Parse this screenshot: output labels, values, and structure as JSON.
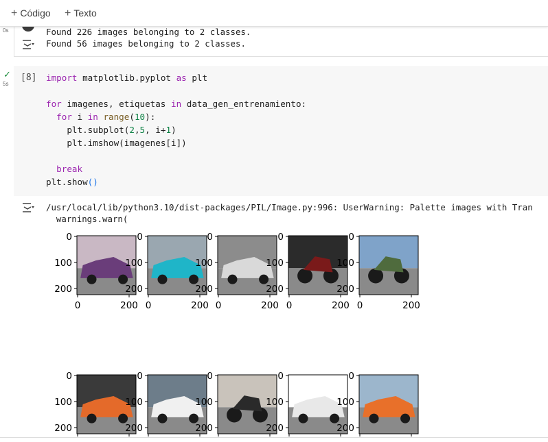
{
  "toolbar": {
    "add_code": "Código",
    "add_text": "Texto"
  },
  "cell1": {
    "exec_time": "0s",
    "output_lines": [
      "Found 226 images belonging to 2 classes.",
      "Found 56 images belonging to 2 classes."
    ]
  },
  "cell2": {
    "exec_time": "5s",
    "prompt": "[8]",
    "code": {
      "l1_kw": "import",
      "l1_rest": " matplotlib.pyplot ",
      "l1_kw2": "as",
      "l1_end": " plt",
      "l2_kw": "for",
      "l2_mid": " imagenes, etiquetas ",
      "l2_kw2": "in",
      "l2_end": " data_gen_entrenamiento:",
      "l3_kw": "for",
      "l3_mid": " i ",
      "l3_kw2": "in",
      "l3_fn": "range",
      "l3_open": "(",
      "l3_num": "10",
      "l3_close": "):",
      "l4_a": "plt.subplot(",
      "l4_n1": "2",
      "l4_c1": ",",
      "l4_n2": "5",
      "l4_c2": ", i+",
      "l4_n3": "1",
      "l4_end": ")",
      "l5": "plt.imshow(imagenes[i])",
      "l6_kw": "break",
      "l7_a": "plt.show",
      "l7_b": "()"
    },
    "output_warning": "/usr/local/lib/python3.10/dist-packages/PIL/Image.py:996: UserWarning: Palette images with Tran",
    "output_warning2": "  warnings.warn("
  },
  "chart_data": {
    "type": "image-grid",
    "rows": 2,
    "cols": 5,
    "x_ticks": [
      "0",
      "200"
    ],
    "y_ticks": [
      "0",
      "100",
      "200"
    ],
    "images": [
      {
        "subject": "purple car",
        "colors": [
          "#c9b8c4",
          "#6a3d7a"
        ]
      },
      {
        "subject": "teal car",
        "colors": [
          "#9aa7b0",
          "#1fb5c8"
        ]
      },
      {
        "subject": "silver car",
        "colors": [
          "#8c8c8c",
          "#d9d9d9"
        ]
      },
      {
        "subject": "black motorcycle",
        "colors": [
          "#2b2b2b",
          "#7a1a1a"
        ]
      },
      {
        "subject": "blue motorcycle",
        "colors": [
          "#7fa3c9",
          "#4f6b3d"
        ]
      },
      {
        "subject": "orange car",
        "colors": [
          "#3a3a3a",
          "#e46a2a"
        ]
      },
      {
        "subject": "white car",
        "colors": [
          "#6d7d8a",
          "#f0f0f0"
        ]
      },
      {
        "subject": "black motorcycle",
        "colors": [
          "#c9c3bb",
          "#2a2a2a"
        ]
      },
      {
        "subject": "white car",
        "colors": [
          "#ffffff",
          "#e8e8e8"
        ]
      },
      {
        "subject": "orange car",
        "colors": [
          "#9cb6cc",
          "#e8702a"
        ]
      }
    ]
  }
}
